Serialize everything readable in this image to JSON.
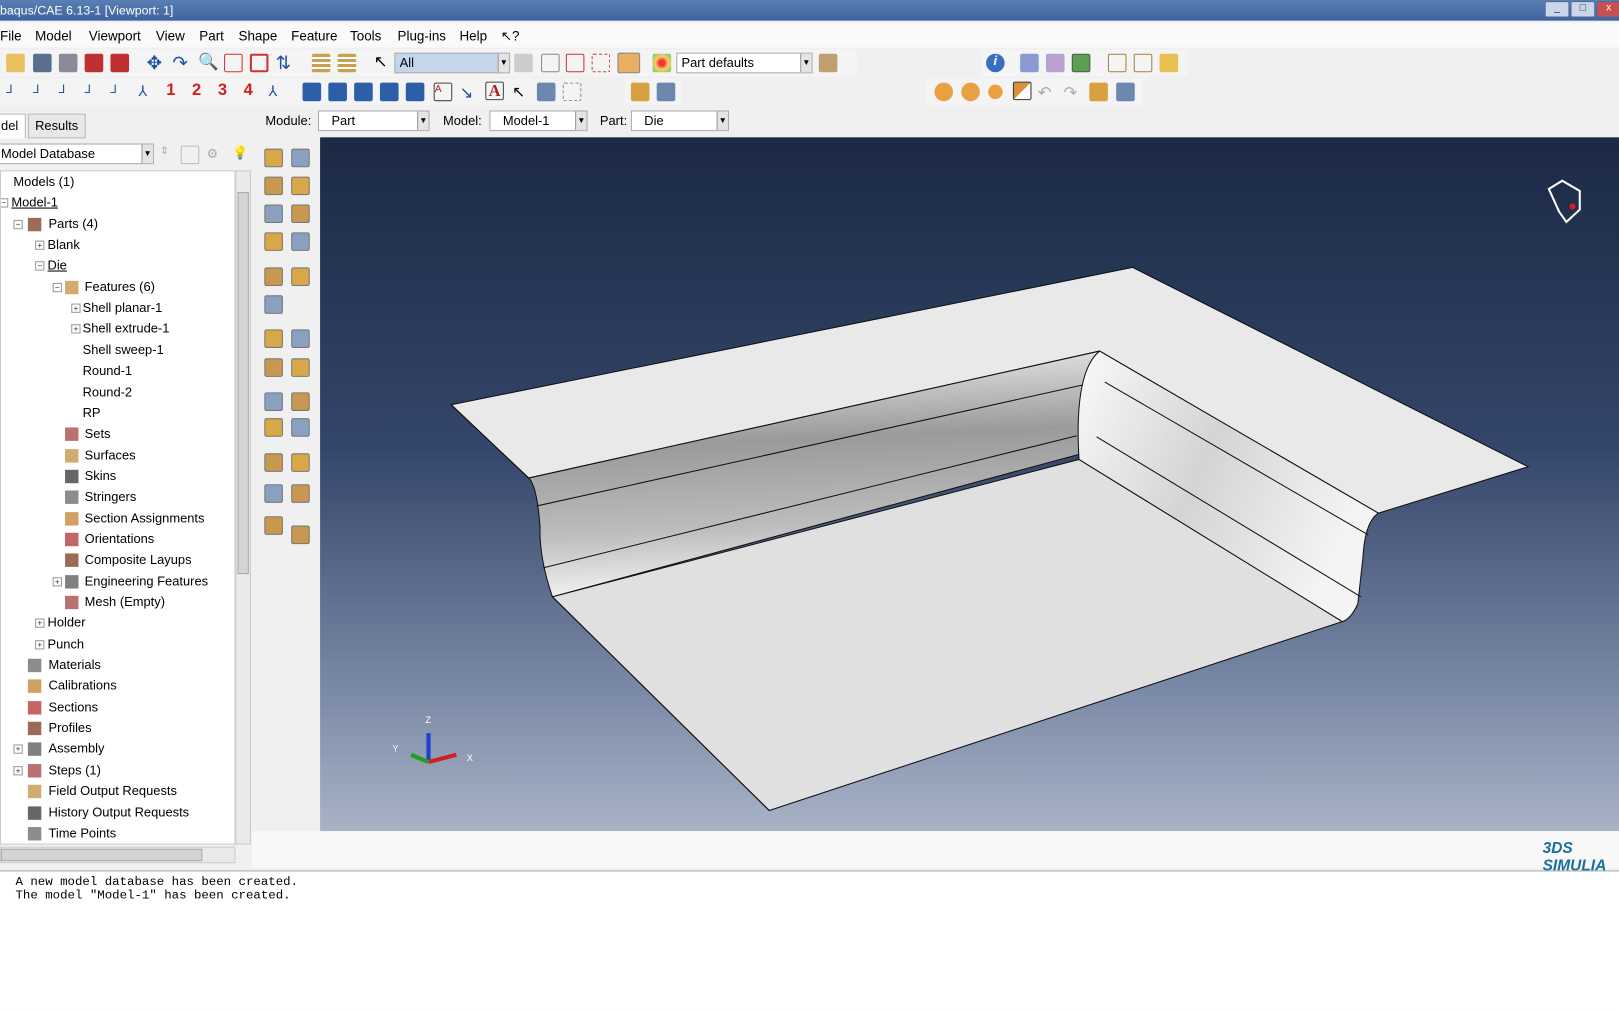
{
  "window": {
    "title": "baqus/CAE 6.13-1 [Viewport: 1]"
  },
  "menu": [
    {
      "label": "File"
    },
    {
      "label": "Model"
    },
    {
      "label": "Viewport"
    },
    {
      "label": "View"
    },
    {
      "label": "Part"
    },
    {
      "label": "Shape"
    },
    {
      "label": "Feature"
    },
    {
      "label": "Tools"
    },
    {
      "label": "Plug-ins"
    },
    {
      "label": "Help"
    },
    {
      "label": "↖?"
    }
  ],
  "toolbar": {
    "selection_filter": "All",
    "render_style": "Part defaults",
    "view_numbers": [
      "1",
      "2",
      "3",
      "4"
    ]
  },
  "context": {
    "module_label": "Module:",
    "module_value": "Part",
    "model_label": "Model:",
    "model_value": "Model-1",
    "part_label": "Part:",
    "part_value": "Die"
  },
  "left_panel": {
    "tabs": [
      "del",
      "Results"
    ],
    "database_combo": "Model Database",
    "tree": [
      {
        "label": "Models (1)",
        "level": 0
      },
      {
        "label": "Model-1",
        "level": 0
      },
      {
        "label": "Parts (4)",
        "level": 1
      },
      {
        "label": "Blank",
        "level": 2
      },
      {
        "label": "Die",
        "level": 2
      },
      {
        "label": "Features (6)",
        "level": 3
      },
      {
        "label": "Shell planar-1",
        "level": 4
      },
      {
        "label": "Shell extrude-1",
        "level": 4
      },
      {
        "label": "Shell sweep-1",
        "level": 4
      },
      {
        "label": "Round-1",
        "level": 4
      },
      {
        "label": "Round-2",
        "level": 4
      },
      {
        "label": "RP",
        "level": 4
      },
      {
        "label": "Sets",
        "level": 3
      },
      {
        "label": "Surfaces",
        "level": 3
      },
      {
        "label": "Skins",
        "level": 3
      },
      {
        "label": "Stringers",
        "level": 3
      },
      {
        "label": "Section Assignments",
        "level": 3
      },
      {
        "label": "Orientations",
        "level": 3
      },
      {
        "label": "Composite Layups",
        "level": 3
      },
      {
        "label": "Engineering Features",
        "level": 3
      },
      {
        "label": "Mesh (Empty)",
        "level": 3
      },
      {
        "label": "Holder",
        "level": 2
      },
      {
        "label": "Punch",
        "level": 2
      },
      {
        "label": "Materials",
        "level": 1
      },
      {
        "label": "Calibrations",
        "level": 1
      },
      {
        "label": "Sections",
        "level": 1
      },
      {
        "label": "Profiles",
        "level": 1
      },
      {
        "label": "Assembly",
        "level": 1
      },
      {
        "label": "Steps (1)",
        "level": 1
      },
      {
        "label": "Field Output Requests",
        "level": 1
      },
      {
        "label": "History Output Requests",
        "level": 1
      },
      {
        "label": "Time Points",
        "level": 1
      }
    ]
  },
  "viewport": {
    "triad": {
      "x": "X",
      "y": "Y",
      "z": "Z"
    },
    "logo": "3DS SIMULIA"
  },
  "messages": [
    "A new model database has been created.",
    "The model \"Model-1\" has been created."
  ],
  "colors": {
    "title_bar": "#4a70aa",
    "viewport_top": "#1b2944",
    "viewport_bottom": "#a9b3c6",
    "part_surface": "#e6e6e6"
  }
}
